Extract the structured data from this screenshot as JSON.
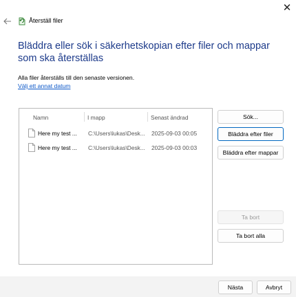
{
  "window": {
    "title": "Återställ filer",
    "close_symbol": "✕",
    "back_icon": "back-arrow-icon",
    "app_icon": "restore-files-icon"
  },
  "main": {
    "heading": "Bläddra eller sök i säkerhetskopian efter filer och mappar som ska återställas",
    "info_text": "Alla filer återställs till den senaste versionen.",
    "choose_date_link": "Välj ett annat datum"
  },
  "file_list": {
    "columns": [
      "Namn",
      "I mapp",
      "Senast ändrad"
    ],
    "rows": [
      {
        "name": "Here my test ...",
        "folder": "C:\\Users\\lukas\\Desk...",
        "modified": "2025-09-03 00:05",
        "icon": "document-icon"
      },
      {
        "name": "Here my test ...",
        "folder": "C:\\Users\\lukas\\Desk...",
        "modified": "2025-09-03 00:03",
        "icon": "document-icon"
      }
    ]
  },
  "side_buttons": {
    "search": "Sök...",
    "browse_files": "Bläddra efter filer",
    "browse_folders": "Bläddra efter mappar",
    "remove": "Ta bort",
    "remove_all": "Ta bort alla"
  },
  "footer": {
    "next": "Nästa",
    "cancel": "Avbryt"
  },
  "colors": {
    "heading": "#1c3a8a",
    "link": "#0b57c8",
    "primary_border": "#0067c0",
    "footer_bg": "#f3f3f3"
  }
}
